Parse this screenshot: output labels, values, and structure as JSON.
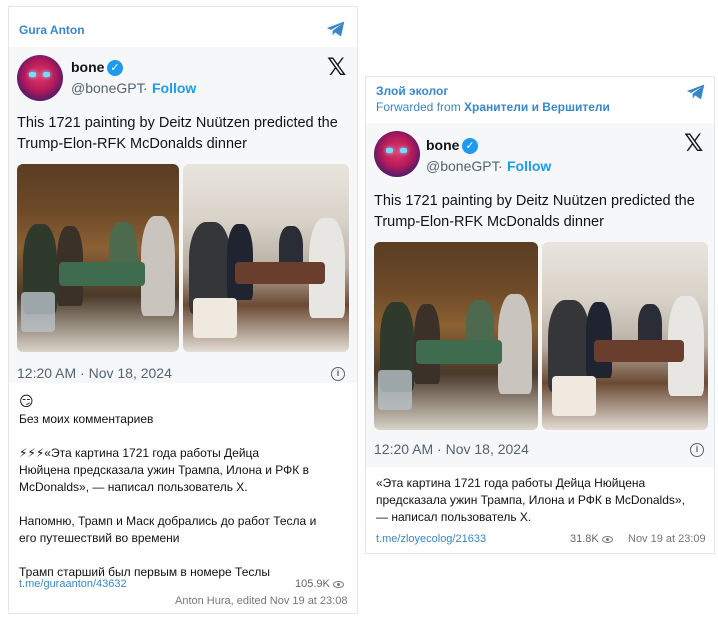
{
  "left_post": {
    "channel": "Gura Anton",
    "tweet": {
      "name": "bone",
      "handle": "@boneGPT",
      "separator": "·",
      "follow": "Follow",
      "text_line1": "This 1721 painting by Deitz Nuützen predicted the",
      "text_line2": "Trump-Elon-RFK McDonalds dinner",
      "timestamp": "12:20 AM · Nov 18, 2024"
    },
    "emoji": "😏",
    "message_lines": [
      "Без моих комментариев",
      "",
      "⚡⚡⚡«Эта картина 1721 года работы Дейца",
      "Нюйцена предсказала ужин Трампа, Илона и РФК в",
      "McDonalds», — написал пользователь X.",
      "",
      "Напомню, Трамп и Маск добрались до работ Тесла и",
      "его путешествий во времени",
      "",
      "Трамп старший был первым в номере Теслы"
    ],
    "link": "t.me/guraanton/43632",
    "views": "105.9K",
    "footer": "Anton Hura, edited  Nov 19 at 23:08"
  },
  "right_post": {
    "channel": "Злой эколог",
    "forwarded_prefix": "Forwarded from",
    "forwarded_source": "Хранители и Вершители",
    "tweet": {
      "name": "bone",
      "handle": "@boneGPT",
      "separator": "·",
      "follow": "Follow",
      "text_line1": "This 1721 painting by Deitz Nuützen predicted the",
      "text_line2": "Trump-Elon-RFK McDonalds dinner",
      "timestamp": "12:20 AM · Nov 18, 2024"
    },
    "message_lines": [
      "«Эта картина 1721 года работы Дейца Нюйцена",
      "предсказала ужин Трампа, Илона и РФК в McDonalds»,",
      "— написал пользователь X."
    ],
    "link": "t.me/zloyecolog/21633",
    "views": "31.8K",
    "time": "Nov 19 at 23:09"
  },
  "icons": {
    "telegram": "telegram-icon",
    "x_logo": "x-logo-icon",
    "verified": "verified-badge-icon",
    "info": "info-icon",
    "views": "eye-icon"
  },
  "colors": {
    "telegram_blue": "#3a87c8",
    "twitter_blue": "#1d9bf0"
  }
}
